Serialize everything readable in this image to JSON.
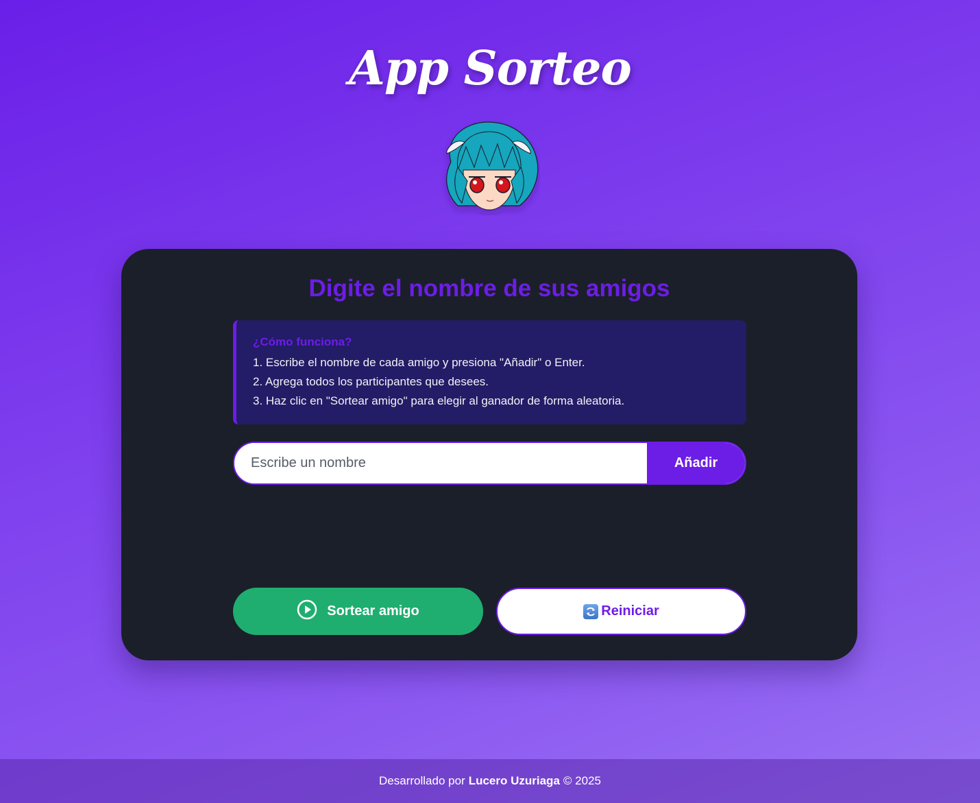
{
  "header": {
    "title": "App Sorteo"
  },
  "card": {
    "title": "Digite el nombre de sus amigos",
    "howto": {
      "title": "¿Cómo funciona?",
      "steps": [
        "1. Escribe el nombre de cada amigo y presiona \"Añadir\" o Enter.",
        "2. Agrega todos los participantes que desees.",
        "3. Haz clic en \"Sortear amigo\" para elegir al ganador de forma aleatoria."
      ]
    },
    "input": {
      "placeholder": "Escribe un nombre",
      "value": ""
    },
    "add_label": "Añadir",
    "draw_label": "Sortear amigo",
    "reset_label": "Reiniciar"
  },
  "footer": {
    "prefix": "Desarrollado por",
    "author": "Lucero Uzuriaga",
    "suffix": "© 2025"
  },
  "colors": {
    "accent": "#6c1de6",
    "card_bg": "#1b1f29",
    "draw_button": "#1fae70",
    "howto_bg": "#231c66"
  }
}
